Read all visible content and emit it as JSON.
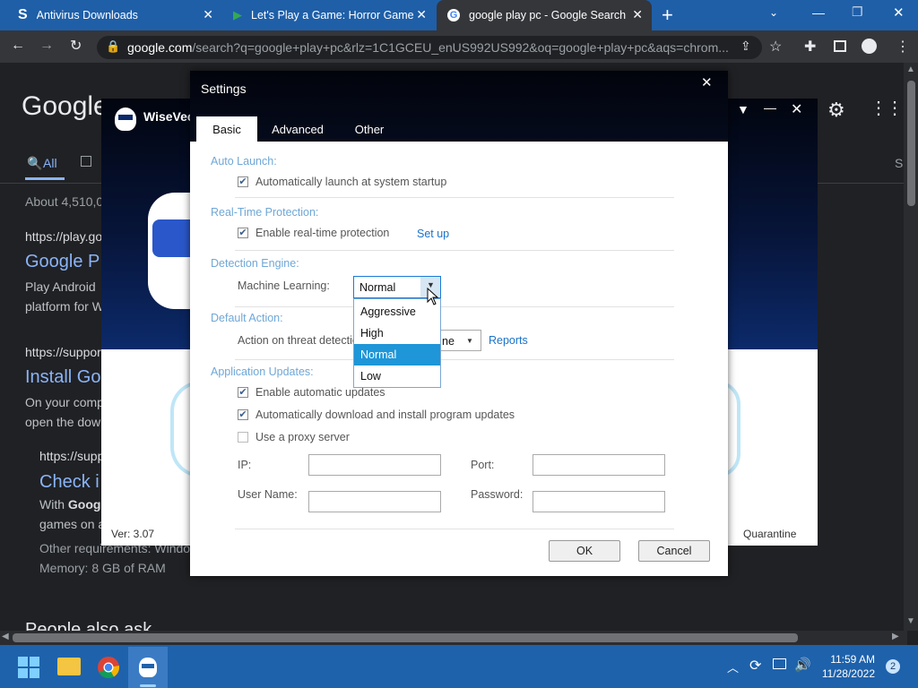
{
  "browser": {
    "tabs": [
      {
        "title": "Antivirus Downloads",
        "icon": "s-logo-icon"
      },
      {
        "title": "Let's Play a Game: Horror Game",
        "icon": "play-store-icon"
      },
      {
        "title": "google play pc - Google Search",
        "icon": "google-icon"
      }
    ],
    "url_host": "google.com",
    "url_path": "/search?q=google+play+pc&rlz=1C1GCEU_enUS992US992&oq=google+play+pc&aqs=chrom..."
  },
  "search_page": {
    "logo": "Google",
    "tab_all": "All",
    "results_count": "About 4,510,0",
    "result1_url": "https://play.go",
    "result1_title": "Google P",
    "result1_snip1": "Play Android",
    "result1_snip2": "platform for W",
    "result2_url": "https://suppor",
    "result2_title": "Install Go",
    "result2_snip1": "On your comp",
    "result2_snip2": "open the dow",
    "result3_url": "https://supp",
    "result3_title": "Check i",
    "result3_snip1_a": "With ",
    "result3_snip1_b": "Goog",
    "result3_snip2": "games on a",
    "req": "Other requirements: Windo",
    "memory": "Memory: 8 GB of RAM",
    "people_also_ask": "People also ask",
    "side_letter": "S"
  },
  "wisevector": {
    "title": "WiseVec",
    "version": "Ver: 3.07",
    "quarantine": "Quarantine"
  },
  "settings": {
    "title": "Settings",
    "tabs": [
      "Basic",
      "Advanced",
      "Other"
    ],
    "sections": {
      "auto_launch": "Auto Launch:",
      "realtime": "Real-Time Protection:",
      "engine": "Detection Engine:",
      "default_action": "Default Action:",
      "updates": "Application Updates:"
    },
    "auto_launch_label": "Automatically launch at system startup",
    "realtime_label": "Enable real-time protection",
    "setup_link": "Set up",
    "ml_label": "Machine Learning:",
    "ml_value": "Normal",
    "ml_options": [
      "Aggressive",
      "High",
      "Normal",
      "Low"
    ],
    "threat_label": "Action on threat detectio",
    "threat_value_tail": "ne",
    "reports_link": "Reports",
    "auto_updates": "Enable automatic updates",
    "auto_download": "Automatically download and install program updates",
    "proxy": "Use a proxy server",
    "ip_label": "IP:",
    "port_label": "Port:",
    "username_label": "User Name:",
    "password_label": "Password:",
    "ok": "OK",
    "cancel": "Cancel"
  },
  "taskbar": {
    "time": "11:59 AM",
    "date": "11/28/2022",
    "notifications": "2"
  }
}
